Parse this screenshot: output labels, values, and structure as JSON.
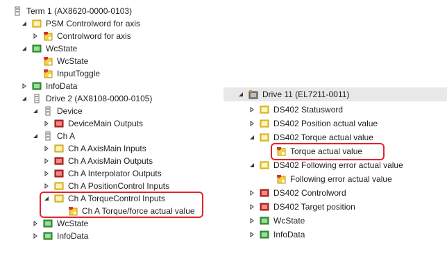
{
  "left_tree": {
    "items": [
      {
        "label": "Term 1 (AX8620-0000-0103)",
        "icon": "device-terminal-icon",
        "arrow": "expanded"
      },
      {
        "label": "PSM Controlword for axis",
        "icon": "yellow-folder-icon",
        "arrow": "expanded"
      },
      {
        "label": "Controlword for axis",
        "icon": "output-var-icon",
        "arrow": "collapsed"
      },
      {
        "label": "WcState",
        "icon": "green-folder-icon",
        "arrow": "expanded"
      },
      {
        "label": "WcState",
        "icon": "input-var-icon",
        "arrow": "none"
      },
      {
        "label": "InputToggle",
        "icon": "input-var-icon",
        "arrow": "none"
      },
      {
        "label": "InfoData",
        "icon": "green-folder-icon",
        "arrow": "collapsed"
      },
      {
        "label": "Drive 2 (AX8108-0000-0105)",
        "icon": "device-terminal-icon",
        "arrow": "expanded"
      },
      {
        "label": "Device",
        "icon": "device-terminal-icon",
        "arrow": "expanded"
      },
      {
        "label": "DeviceMain Outputs",
        "icon": "red-folder-icon",
        "arrow": "collapsed"
      },
      {
        "label": "Ch A",
        "icon": "device-terminal-icon",
        "arrow": "expanded"
      },
      {
        "label": "Ch A AxisMain Inputs",
        "icon": "yellow-folder-icon",
        "arrow": "collapsed"
      },
      {
        "label": "Ch A AxisMain Outputs",
        "icon": "red-folder-icon",
        "arrow": "collapsed"
      },
      {
        "label": "Ch A Interpolator Outputs",
        "icon": "red-folder-icon",
        "arrow": "collapsed"
      },
      {
        "label": "Ch A PositionControl Inputs",
        "icon": "yellow-folder-icon",
        "arrow": "collapsed"
      },
      {
        "label": "Ch A TorqueControl Inputs",
        "icon": "yellow-folder-icon",
        "arrow": "expanded"
      },
      {
        "label": "Ch A Torque/force actual value",
        "icon": "input-var-icon",
        "arrow": "none"
      },
      {
        "label": "WcState",
        "icon": "green-folder-icon",
        "arrow": "collapsed"
      },
      {
        "label": "InfoData",
        "icon": "green-folder-icon",
        "arrow": "collapsed"
      }
    ]
  },
  "right_tree": {
    "items": [
      {
        "label": "Drive 11 (EL7211-0011)",
        "icon": "drive-terminal-icon",
        "arrow": "expanded"
      },
      {
        "label": "DS402 Statusword",
        "icon": "yellow-folder-icon",
        "arrow": "collapsed"
      },
      {
        "label": "DS402 Position actual value",
        "icon": "yellow-folder-icon",
        "arrow": "collapsed"
      },
      {
        "label": "DS402 Torque actual value",
        "icon": "yellow-folder-icon",
        "arrow": "expanded"
      },
      {
        "label": "Torque actual value",
        "icon": "input-var-icon",
        "arrow": "none"
      },
      {
        "label": "DS402 Following error actual value",
        "icon": "yellow-folder-icon",
        "arrow": "expanded"
      },
      {
        "label": "Following error actual value",
        "icon": "input-var-icon",
        "arrow": "none"
      },
      {
        "label": "DS402 Controlword",
        "icon": "red-folder-icon",
        "arrow": "collapsed"
      },
      {
        "label": "DS402 Target position",
        "icon": "red-folder-icon",
        "arrow": "collapsed"
      },
      {
        "label": "WcState",
        "icon": "green-folder-icon",
        "arrow": "collapsed"
      },
      {
        "label": "InfoData",
        "icon": "green-folder-icon",
        "arrow": "collapsed"
      }
    ]
  },
  "colors": {
    "highlight_border": "#e0242b",
    "yellow_folder": "#f6d33c",
    "red_folder": "#cc2a2a",
    "green_folder": "#3aa53a",
    "header_band": "#e8e8e8"
  }
}
